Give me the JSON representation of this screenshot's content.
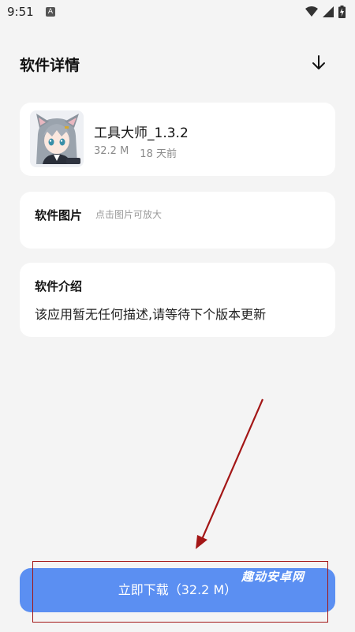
{
  "status_bar": {
    "time": "9:51",
    "notification_badge": "A",
    "icons": [
      "wifi-icon",
      "signal-icon",
      "battery-charging-icon"
    ]
  },
  "header": {
    "title": "软件详情",
    "action_icon": "download-arrow-icon"
  },
  "app": {
    "name": "工具大师_1.3.2",
    "size": "32.2 M",
    "age": "18 天前",
    "icon": "anime-cat-girl-avatar"
  },
  "images_section": {
    "title": "软件图片",
    "hint": "点击图片可放大"
  },
  "description_section": {
    "title": "软件介绍",
    "text": "该应用暂无任何描述,请等待下个版本更新"
  },
  "download_button": {
    "label": "立即下载（32.2 M）",
    "color": "#5b8ff2"
  },
  "annotation": {
    "arrow_color": "#a31616",
    "watermark": "趣动安卓网"
  }
}
